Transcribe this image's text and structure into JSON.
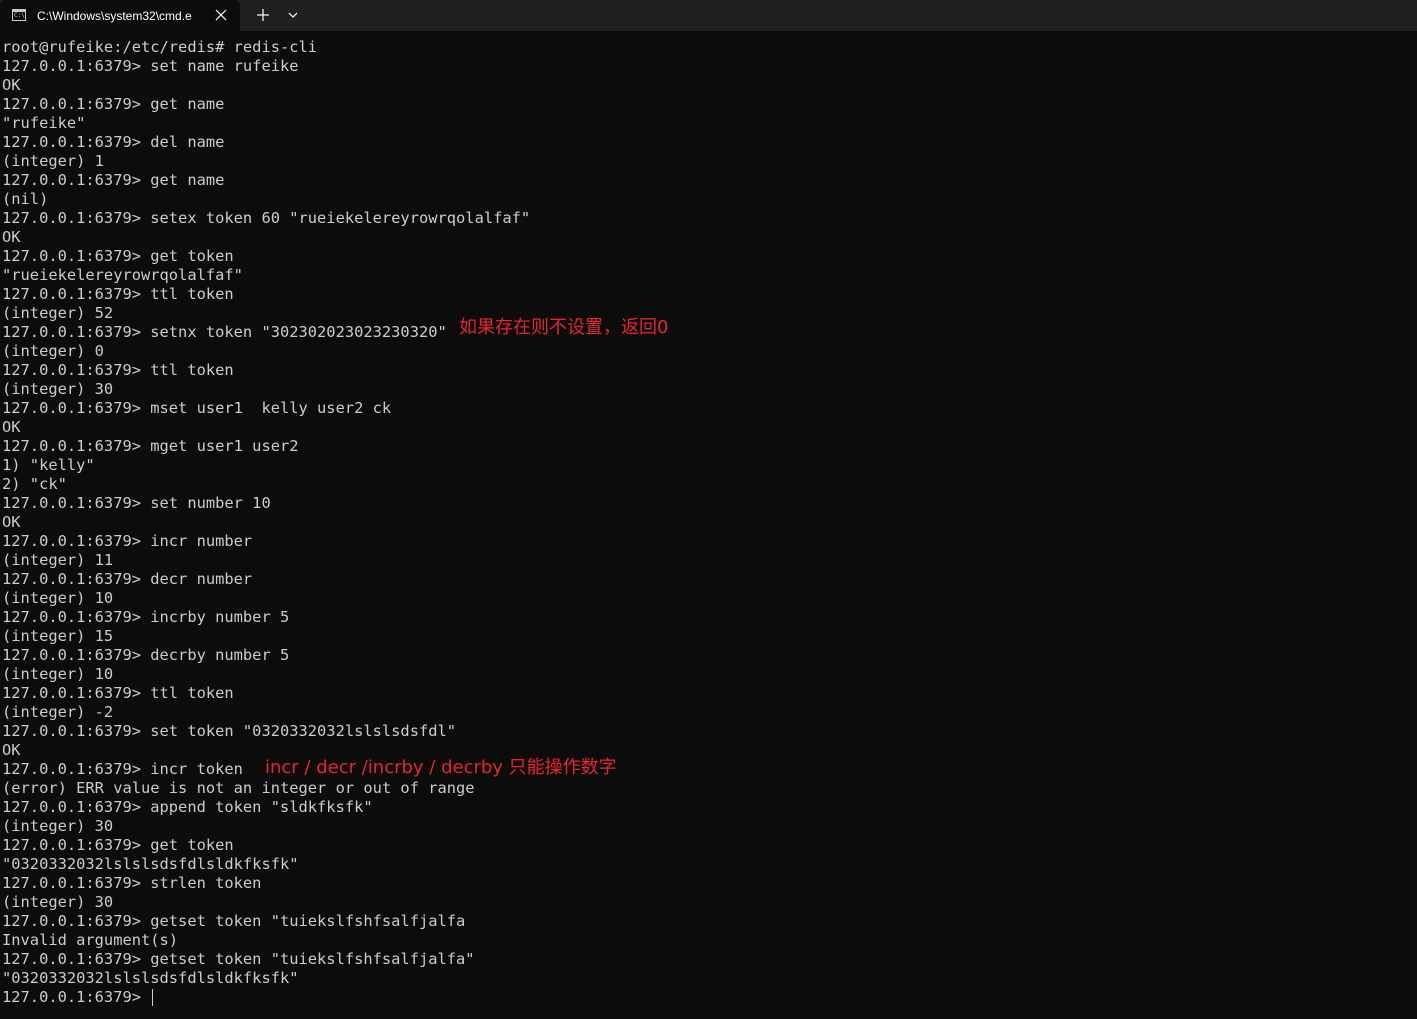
{
  "window": {
    "tab_title": "C:\\Windows\\system32\\cmd.e",
    "icons": {
      "tab": "console-icon",
      "close": "close-icon",
      "new_tab": "plus-icon",
      "dropdown": "chevron-down-icon"
    }
  },
  "colors": {
    "background": "#0c0c0c",
    "titlebar": "#202020",
    "text": "#cccccc",
    "annotation": "#e8242f"
  },
  "terminal": {
    "lines": [
      "root@rufeike:/etc/redis# redis-cli",
      "127.0.0.1:6379> set name rufeike",
      "OK",
      "127.0.0.1:6379> get name",
      "\"rufeike\"",
      "127.0.0.1:6379> del name",
      "(integer) 1",
      "127.0.0.1:6379> get name",
      "(nil)",
      "127.0.0.1:6379> setex token 60 \"rueiekelereyrowrqolalfaf\"",
      "OK",
      "127.0.0.1:6379> get token",
      "\"rueiekelereyrowrqolalfaf\"",
      "127.0.0.1:6379> ttl token",
      "(integer) 52",
      "127.0.0.1:6379> setnx token \"302302023023230320\"",
      "(integer) 0",
      "127.0.0.1:6379> ttl token",
      "(integer) 30",
      "127.0.0.1:6379> mset user1  kelly user2 ck",
      "OK",
      "127.0.0.1:6379> mget user1 user2",
      "1) \"kelly\"",
      "2) \"ck\"",
      "127.0.0.1:6379> set number 10",
      "OK",
      "127.0.0.1:6379> incr number",
      "(integer) 11",
      "127.0.0.1:6379> decr number",
      "(integer) 10",
      "127.0.0.1:6379> incrby number 5",
      "(integer) 15",
      "127.0.0.1:6379> decrby number 5",
      "(integer) 10",
      "127.0.0.1:6379> ttl token",
      "(integer) -2",
      "127.0.0.1:6379> set token \"0320332032lslslsdsfdl\"",
      "OK",
      "127.0.0.1:6379> incr token",
      "(error) ERR value is not an integer or out of range",
      "127.0.0.1:6379> append token \"sldkfksfk\"",
      "(integer) 30",
      "127.0.0.1:6379> get token",
      "\"0320332032lslslsdsfdlsldkfksfk\"",
      "127.0.0.1:6379> strlen token",
      "(integer) 30",
      "127.0.0.1:6379> getset token \"tuiekslfshfsalfjalfa",
      "Invalid argument(s)",
      "127.0.0.1:6379> getset token \"tuiekslfshfsalfjalfa\"",
      "\"0320332032lslslsdsfdlsldkfksfk\"",
      "127.0.0.1:6379> "
    ]
  },
  "annotations": {
    "setnx_note": "如果存在则不设置，返回0",
    "incr_note": "incr / decr /incrby / decrby 只能操作数字"
  }
}
